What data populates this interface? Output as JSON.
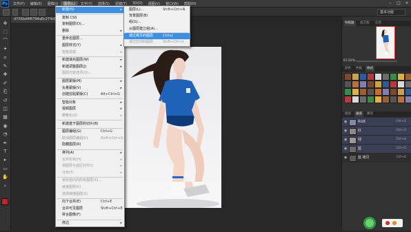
{
  "app": {
    "logo": "Ps"
  },
  "menubar": {
    "items": [
      "文件(F)",
      "编辑(E)",
      "图像(I)",
      "图层(L)",
      "文字(Y)",
      "选择(S)",
      "滤镜(T)",
      "3D(D)",
      "视图(V)",
      "窗口(W)",
      "帮助(H)"
    ],
    "active_index": 3,
    "window_controls": [
      "–",
      "□",
      "×"
    ]
  },
  "options_bar": {
    "workspace_value": "基本功能"
  },
  "document": {
    "tab_label": "d756bd4f6794a6c274c8130..."
  },
  "layer_menu": {
    "items": [
      {
        "label": "新建(N)",
        "shortcut": "",
        "submenu": true,
        "state": "highlight"
      },
      {
        "label": "复制 CSS",
        "shortcut": "",
        "submenu": false,
        "state": "normal"
      },
      {
        "label": "复制图层(D)...",
        "shortcut": "",
        "submenu": false,
        "state": "normal"
      },
      {
        "label": "删除",
        "shortcut": "",
        "submenu": true,
        "state": "normal"
      },
      {
        "label": "重命名图层...",
        "shortcut": "",
        "submenu": false,
        "state": "normal"
      },
      {
        "label": "图层样式(Y)",
        "shortcut": "",
        "submenu": true,
        "state": "normal"
      },
      {
        "label": "智能滤镜",
        "shortcut": "",
        "submenu": true,
        "state": "disabled"
      },
      {
        "label": "新建填充图层(W)",
        "shortcut": "",
        "submenu": true,
        "state": "normal"
      },
      {
        "label": "新建调整图层(J)",
        "shortcut": "",
        "submenu": true,
        "state": "normal"
      },
      {
        "label": "图层内容选项(O)...",
        "shortcut": "",
        "submenu": false,
        "state": "disabled"
      },
      {
        "label": "图层蒙版(M)",
        "shortcut": "",
        "submenu": true,
        "state": "normal"
      },
      {
        "label": "矢量蒙版(V)",
        "shortcut": "",
        "submenu": true,
        "state": "normal"
      },
      {
        "label": "创建剪贴蒙版(C)",
        "shortcut": "Alt+Ctrl+G",
        "submenu": false,
        "state": "normal"
      },
      {
        "label": "智能对象",
        "shortcut": "",
        "submenu": true,
        "state": "normal"
      },
      {
        "label": "视频图层",
        "shortcut": "",
        "submenu": true,
        "state": "normal"
      },
      {
        "label": "栅格化(Z)",
        "shortcut": "",
        "submenu": true,
        "state": "disabled"
      },
      {
        "label": "新建基于图层的切片(B)",
        "shortcut": "",
        "submenu": false,
        "state": "normal"
      },
      {
        "label": "图层编组(G)",
        "shortcut": "Ctrl+G",
        "submenu": false,
        "state": "normal"
      },
      {
        "label": "取消图层编组(U)",
        "shortcut": "Shift+Ctrl+G",
        "submenu": false,
        "state": "disabled"
      },
      {
        "label": "隐藏图层(R)",
        "shortcut": "",
        "submenu": false,
        "state": "normal"
      },
      {
        "label": "排列(A)",
        "shortcut": "",
        "submenu": true,
        "state": "normal"
      },
      {
        "label": "合并形状(H)",
        "shortcut": "",
        "submenu": true,
        "state": "disabled"
      },
      {
        "label": "将图层与选区对齐(I)",
        "shortcut": "",
        "submenu": true,
        "state": "disabled"
      },
      {
        "label": "分布(T)",
        "shortcut": "",
        "submenu": true,
        "state": "disabled"
      },
      {
        "label": "锁定组内的所有图层(X)...",
        "shortcut": "",
        "submenu": false,
        "state": "disabled"
      },
      {
        "label": "链接图层(K)",
        "shortcut": "",
        "submenu": false,
        "state": "disabled"
      },
      {
        "label": "选择链接图层(S)",
        "shortcut": "",
        "submenu": false,
        "state": "disabled"
      },
      {
        "label": "向下合并(E)",
        "shortcut": "Ctrl+E",
        "submenu": false,
        "state": "normal"
      },
      {
        "label": "合并可见图层",
        "shortcut": "Shift+Ctrl+E",
        "submenu": false,
        "state": "normal"
      },
      {
        "label": "拼合图像(F)",
        "shortcut": "",
        "submenu": false,
        "state": "normal"
      },
      {
        "label": "修边",
        "shortcut": "",
        "submenu": true,
        "state": "normal"
      }
    ]
  },
  "new_submenu": {
    "items": [
      {
        "label": "图层(L)...",
        "shortcut": "Shift+Ctrl+N",
        "state": "normal"
      },
      {
        "label": "背景图层(B)",
        "shortcut": "",
        "state": "normal"
      },
      {
        "label": "组(G)...",
        "shortcut": "",
        "state": "normal"
      },
      {
        "label": "从图层建立组(A)...",
        "shortcut": "",
        "state": "normal"
      },
      {
        "label": "通过拷贝的图层",
        "shortcut": "Ctrl+J",
        "state": "highlight"
      },
      {
        "label": "通过剪切的图层",
        "shortcut": "Shift+Ctrl+J",
        "state": "disabled"
      }
    ]
  },
  "panels": {
    "top_tabs": [
      "导航器",
      "直方图",
      "信息"
    ],
    "zoom_value": "67.02%",
    "style_tabs": [
      "颜色",
      "色板",
      "样式"
    ],
    "layer_tabs": [
      "图层",
      "通道",
      "路径"
    ],
    "channels": [
      {
        "name": "RGB",
        "shortcut": "Ctrl+2"
      },
      {
        "name": "红",
        "shortcut": "Ctrl+3"
      },
      {
        "name": "绿",
        "shortcut": "Ctrl+4"
      },
      {
        "name": "蓝",
        "shortcut": "Ctrl+5"
      },
      {
        "name": "蓝 拷贝",
        "shortcut": "Ctrl+6"
      }
    ]
  },
  "colors": {
    "menu_highlight": "#3c8fe3",
    "photo_bg": "#eeeeef",
    "jersey": "#1f63b8",
    "foreground_swatch": "#c0262b"
  },
  "icons": [
    "move-icon",
    "marquee-icon",
    "lasso-icon",
    "magic-wand-icon",
    "crop-icon",
    "eyedropper-icon",
    "healing-icon",
    "brush-icon",
    "stamp-icon",
    "history-brush-icon",
    "eraser-icon",
    "gradient-icon",
    "blur-icon",
    "dodge-icon",
    "pen-icon",
    "type-icon",
    "path-select-icon",
    "shape-icon",
    "hand-icon",
    "zoom-icon"
  ]
}
